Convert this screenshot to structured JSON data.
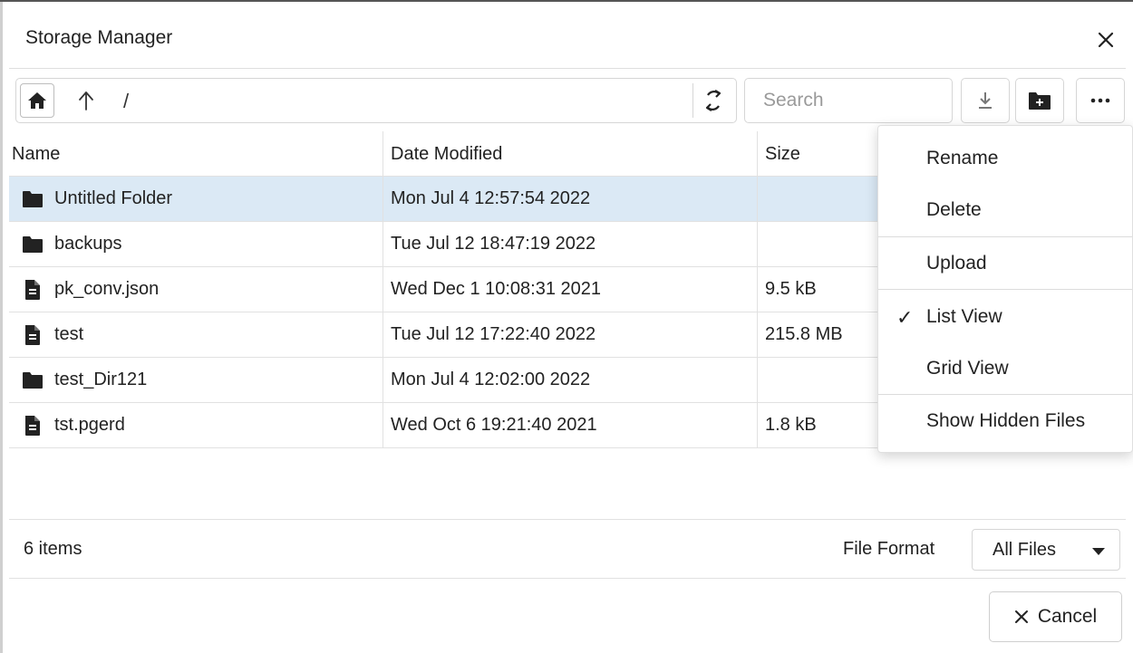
{
  "dialog": {
    "title": "Storage Manager",
    "close_icon": "close-icon"
  },
  "toolbar": {
    "home_icon": "home-icon",
    "up_icon": "arrow-up-icon",
    "path": "/",
    "refresh_icon": "refresh-icon",
    "search_placeholder": "Search",
    "download_icon": "download-icon",
    "new_folder_icon": "new-folder-icon",
    "more_icon": "more-icon"
  },
  "table": {
    "columns": [
      "Name",
      "Date Modified",
      "Size"
    ],
    "rows": [
      {
        "icon": "folder-icon",
        "name": "Untitled Folder",
        "modified": "Mon Jul 4 12:57:54 2022",
        "size": "",
        "selected": true
      },
      {
        "icon": "folder-icon",
        "name": "backups",
        "modified": "Tue Jul 12 18:47:19 2022",
        "size": ""
      },
      {
        "icon": "file-icon",
        "name": "pk_conv.json",
        "modified": "Wed Dec 1 10:08:31 2021",
        "size": "9.5 kB"
      },
      {
        "icon": "file-icon",
        "name": "test",
        "modified": "Tue Jul 12 17:22:40 2022",
        "size": "215.8 MB"
      },
      {
        "icon": "folder-icon",
        "name": "test_Dir121",
        "modified": "Mon Jul 4 12:02:00 2022",
        "size": ""
      },
      {
        "icon": "file-icon",
        "name": "tst.pgerd",
        "modified": "Wed Oct 6 19:21:40 2021",
        "size": "1.8 kB"
      }
    ]
  },
  "menu": {
    "items": [
      {
        "label": "Rename"
      },
      {
        "label": "Delete"
      },
      {
        "label": "Upload"
      },
      {
        "label": "List View",
        "checked": true
      },
      {
        "label": "Grid View"
      },
      {
        "label": "Show Hidden Files"
      }
    ],
    "check_mark": "✓"
  },
  "footer": {
    "item_count": "6 items",
    "file_format_label": "File Format",
    "file_format_value": "All Files",
    "cancel_label": "Cancel",
    "cancel_icon": "close-icon"
  }
}
